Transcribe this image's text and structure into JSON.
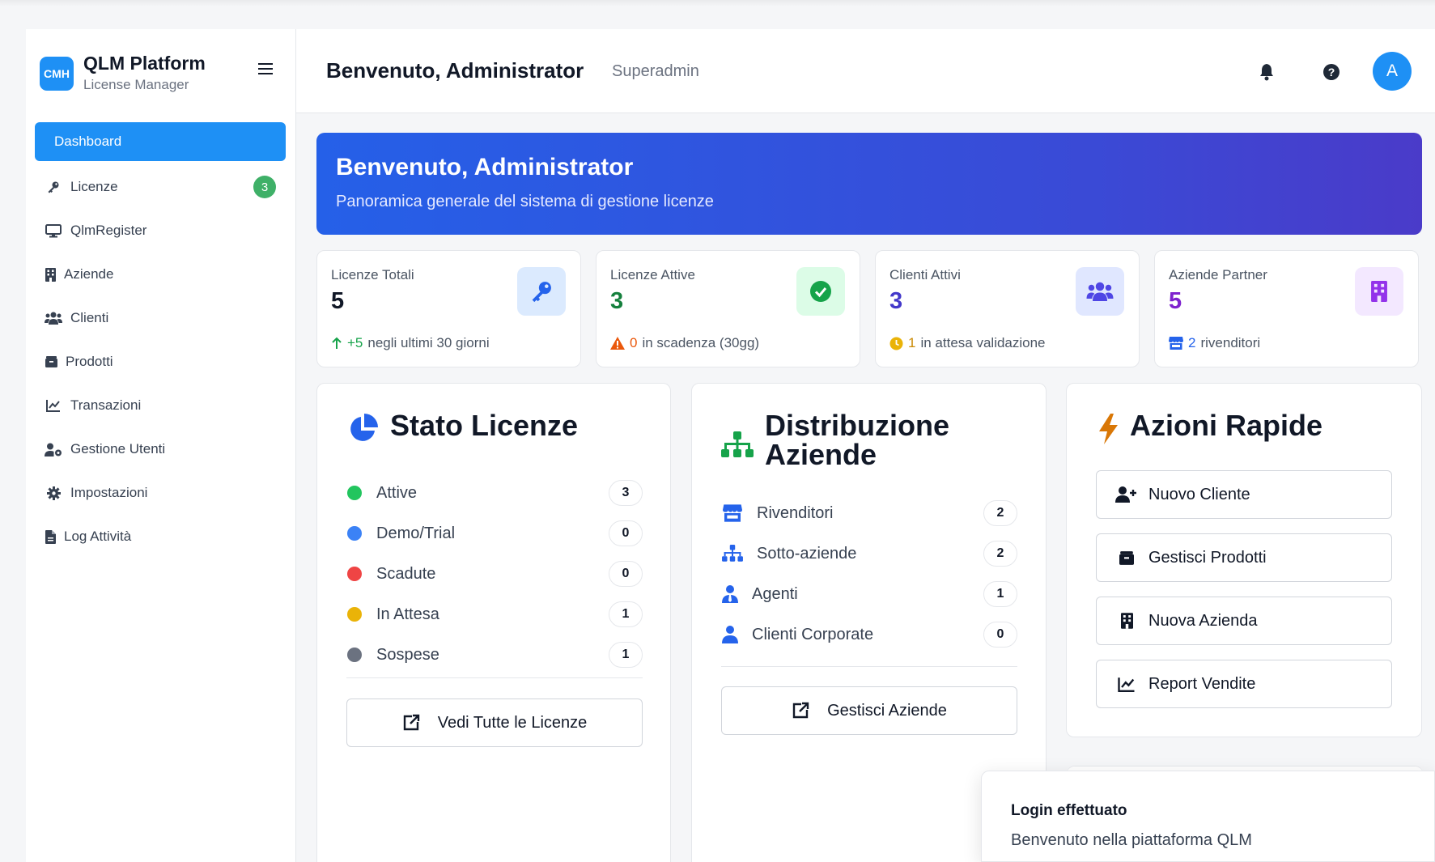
{
  "brand": {
    "logo": "CMH",
    "title": "QLM Platform",
    "subtitle": "License Manager"
  },
  "sidebar": {
    "items": [
      {
        "label": "Dashboard",
        "icon": "dashboard",
        "active": true
      },
      {
        "label": "Licenze",
        "icon": "key-icon",
        "badge": "3"
      },
      {
        "label": "QlmRegister",
        "icon": "monitor-icon"
      },
      {
        "label": "Aziende",
        "icon": "building-icon"
      },
      {
        "label": "Clienti",
        "icon": "users-icon"
      },
      {
        "label": "Prodotti",
        "icon": "box-icon"
      },
      {
        "label": "Transazioni",
        "icon": "chart-line-icon"
      },
      {
        "label": "Gestione Utenti",
        "icon": "user-cog-icon"
      },
      {
        "label": "Impostazioni",
        "icon": "gear-icon"
      },
      {
        "label": "Log Attività",
        "icon": "file-icon"
      }
    ]
  },
  "header": {
    "title": "Benvenuto, Administrator",
    "role": "Superadmin",
    "avatar": "A"
  },
  "banner": {
    "title": "Benvenuto, Administrator",
    "subtitle": "Panoramica generale del sistema di gestione licenze"
  },
  "stats": [
    {
      "label": "Licenze Totali",
      "value": "5",
      "foot_num": "+5",
      "foot_text": "negli ultimi 30 giorni",
      "value_color": "#111827",
      "num_color": "#16a34a",
      "icon_bg": "#dbeafe"
    },
    {
      "label": "Licenze Attive",
      "value": "3",
      "foot_num": "0",
      "foot_text": "in scadenza (30gg)",
      "value_color": "#15803d",
      "num_color": "#ea580c",
      "icon_bg": "#dcfce7"
    },
    {
      "label": "Clienti Attivi",
      "value": "3",
      "foot_num": "1",
      "foot_text": "in attesa validazione",
      "value_color": "#4338ca",
      "num_color": "#ca8a04",
      "icon_bg": "#e0e7ff"
    },
    {
      "label": "Aziende Partner",
      "value": "5",
      "foot_num": "2",
      "foot_text": "rivenditori",
      "value_color": "#7e22ce",
      "num_color": "#2563eb",
      "icon_bg": "#f3e8ff"
    }
  ],
  "stato": {
    "title": "Stato Licenze",
    "rows": [
      {
        "label": "Attive",
        "count": "3",
        "color": "#22c55e"
      },
      {
        "label": "Demo/Trial",
        "count": "0",
        "color": "#3b82f6"
      },
      {
        "label": "Scadute",
        "count": "0",
        "color": "#ef4444"
      },
      {
        "label": "In Attesa",
        "count": "1",
        "color": "#eab308"
      },
      {
        "label": "Sospese",
        "count": "1",
        "color": "#6b7280"
      }
    ],
    "button": "Vedi Tutte le Licenze"
  },
  "distribuzione": {
    "title_line1": "Distribuzione",
    "title_line2": "Aziende",
    "rows": [
      {
        "label": "Rivenditori",
        "count": "2"
      },
      {
        "label": "Sotto-aziende",
        "count": "2"
      },
      {
        "label": "Agenti",
        "count": "1"
      },
      {
        "label": "Clienti Corporate",
        "count": "0"
      }
    ],
    "button": "Gestisci Aziende"
  },
  "azioni": {
    "title": "Azioni Rapide",
    "buttons": [
      "Nuovo Cliente",
      "Gestisci Prodotti",
      "Nuova Azienda",
      "Report Vendite"
    ]
  },
  "toast": {
    "title": "Login effettuato",
    "message": "Benvenuto nella piattaforma QLM"
  }
}
